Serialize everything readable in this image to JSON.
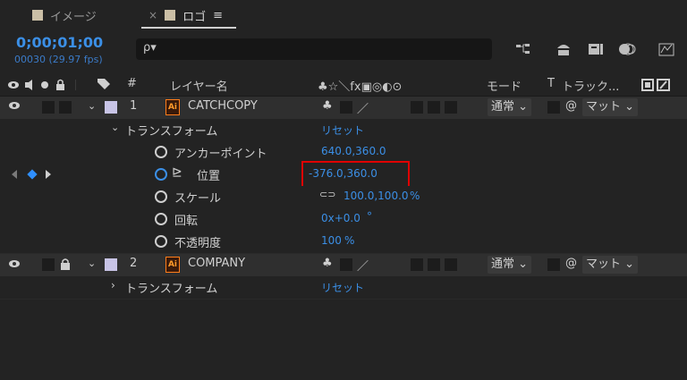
{
  "tabs": [
    {
      "label": "イメージ"
    },
    {
      "label": "ロゴ",
      "menu_glyph": "≡",
      "close_glyph": "×"
    }
  ],
  "time": {
    "timecode": "0;00;01;00",
    "frames": "00030 (29.97 fps)"
  },
  "search": {
    "icon_glyph": "ρ▾"
  },
  "columns": {
    "layer_name": "レイヤー名",
    "number": "#",
    "switches": "♣☆＼fx▣◎◐⊙",
    "mode": "モード",
    "trackmatte_prefix": "T",
    "trackmatte": "トラック..."
  },
  "layers": [
    {
      "number": "1",
      "name": "CATCHCOPY",
      "mode": "通常",
      "matte": "マット",
      "transform": {
        "label": "トランスフォーム",
        "reset": "リセット",
        "props": [
          {
            "label": "アンカーポイント",
            "value": "640.0,360.0"
          },
          {
            "label": "位置",
            "value": "-376.0,360.0"
          },
          {
            "label": "スケール",
            "value": "100.0,100.0",
            "suffix": "%",
            "link_glyph": "⊂⊃"
          },
          {
            "label": "回転",
            "value": "0x+0.0",
            "suffix": "°"
          },
          {
            "label": "不透明度",
            "value": "100",
            "suffix": "%"
          }
        ]
      }
    },
    {
      "number": "2",
      "name": "COMPANY",
      "mode": "通常",
      "matte": "マット",
      "transform": {
        "label": "トランスフォーム",
        "reset": "リセット"
      }
    }
  ],
  "glyphs": {
    "ai": "Ai",
    "shy": "♣",
    "fx_slash": "／",
    "chevron": "⌄",
    "matte_icon": "@",
    "graph_icon": "⊵"
  }
}
